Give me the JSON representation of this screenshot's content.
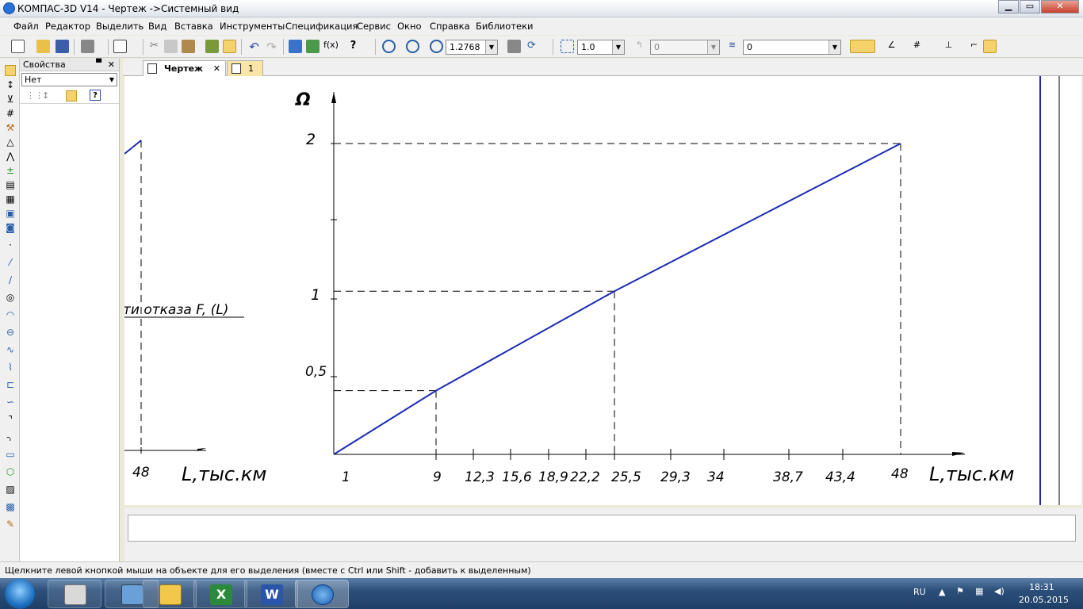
{
  "window": {
    "title": "КОМПАС-3D V14 - Чертеж ->Системный вид",
    "minimize": "▁",
    "maximize": "▭",
    "close": "✕"
  },
  "menu": [
    "Файл",
    "Редактор",
    "Выделить",
    "Вид",
    "Вставка",
    "Инструменты",
    "Спецификация",
    "Сервис",
    "Окно",
    "Справка",
    "Библиотеки"
  ],
  "toolbar": {
    "zoom_value": "1.2768",
    "step_value": "1.0",
    "angle_value": "0",
    "layer_value": "0"
  },
  "properties": {
    "title": "Свойства",
    "pin": "▀",
    "close": "✕",
    "select_value": "Нет",
    "help": "?"
  },
  "tabs": [
    {
      "label": "Чертеж",
      "close": "✕"
    },
    {
      "label": "1"
    }
  ],
  "drawing": {
    "left_fragment": {
      "curve_label": "ти отказа F, (L)",
      "x_tick": "48",
      "x_axis_label": "L,тыс.км"
    },
    "main_plot": {
      "y_axis_label": "Ω",
      "y_ticks": [
        "2",
        "1",
        "0,5"
      ],
      "x_ticks": [
        "1",
        "9",
        "12,3",
        "15,6",
        "18,9",
        "22,2",
        "25,5",
        "29,3",
        "34",
        "38,7",
        "43,4",
        "48"
      ],
      "x_axis_label": "L,тыс.км"
    }
  },
  "chart_data": {
    "type": "line",
    "title": "",
    "xlabel": "L,тыс.км",
    "ylabel": "Ω",
    "x_ticks": [
      "1",
      "9",
      "12,3",
      "15,6",
      "18,9",
      "22,2",
      "25,5",
      "29,3",
      "34",
      "38,7",
      "43,4",
      "48"
    ],
    "y_ticks": [
      "0,5",
      "1",
      "2"
    ],
    "series": [
      {
        "x": [
          1,
          9,
          25.5,
          48
        ],
        "y": [
          0,
          0.41,
          1.05,
          2.0
        ]
      }
    ],
    "guides": [
      {
        "x": 9,
        "y": 0.41
      },
      {
        "x": 25.5,
        "y": 1.05
      },
      {
        "x": 48,
        "y": 2.0
      }
    ]
  },
  "status": {
    "hint": "Щелкните левой кнопкой мыши на объекте для его выделения (вместе с Ctrl или Shift - добавить к выделенным)"
  },
  "taskbar": {
    "lang": "RU",
    "time": "18:31",
    "date": "20.05.2015",
    "apps": [
      "calculator",
      "computer",
      "explorer",
      "excel",
      "word",
      "kompas"
    ],
    "app_letters": [
      "",
      "",
      "",
      "X",
      "W",
      ""
    ]
  }
}
